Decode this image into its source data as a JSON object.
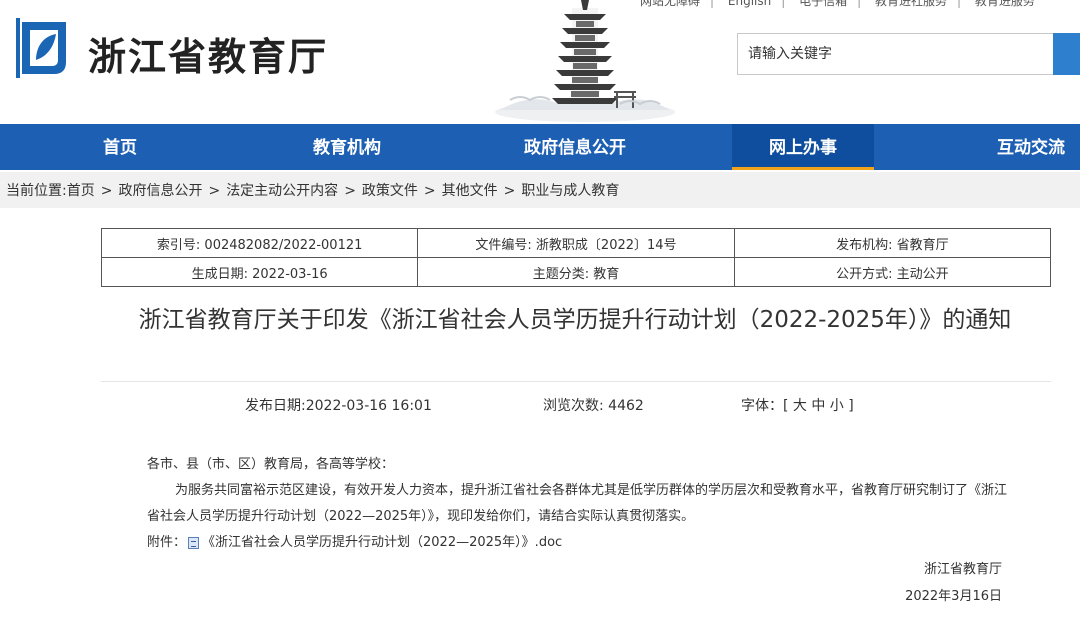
{
  "top_links": [
    "网站无障碍",
    "English",
    "电子信箱",
    "教育进社服务",
    "教育进服务"
  ],
  "site": {
    "name": "浙江省教育厅"
  },
  "search": {
    "placeholder": "请输入关键字"
  },
  "nav": {
    "items": [
      {
        "label": "首页"
      },
      {
        "label": "教育机构"
      },
      {
        "label": "政府信息公开"
      },
      {
        "label": "网上办事",
        "active": true
      },
      {
        "label": "互动交流"
      }
    ]
  },
  "breadcrumb": {
    "prefix": "当前位置:",
    "items": [
      "首页",
      "政府信息公开",
      "法定主动公开内容",
      "政策文件",
      "其他文件",
      "职业与成人教育"
    ]
  },
  "meta": {
    "index_no": "索引号: 002482082/2022-00121",
    "doc_no": "文件编号: 浙教职成〔2022〕14号",
    "publisher": "发布机构: 省教育厅",
    "created": "生成日期: 2022-03-16",
    "topic": "主题分类: 教育",
    "disclosure": "公开方式: 主动公开"
  },
  "article": {
    "title": "浙江省教育厅关于印发《浙江省社会人员学历提升行动计划（2022-2025年）》的通知",
    "publish_date": "发布日期:2022-03-16 16:01",
    "views": "浏览次数: 4462",
    "font_size_label": "字体：[ 大 中 小 ]",
    "salutation": "各市、县（市、区）教育局，各高等学校：",
    "paragraph": "为服务共同富裕示范区建设，有效开发人力资本，提升浙江省社会各群体尤其是低学历群体的学历层次和受教育水平，省教育厅研究制订了《浙江省社会人员学历提升行动计划（2022—2025年）》，现印发给你们，请结合实际认真贯彻落实。",
    "attachment_label": "附件：",
    "attachment_name": "《浙江省社会人员学历提升行动计划（2022—2025年）》.doc",
    "signature": "浙江省教育厅",
    "sign_date": "2022年3月16日"
  },
  "colors": {
    "nav_bg": "#1c5fb3",
    "nav_active": "#0f4e9e",
    "accent": "#f3a31a",
    "search_button": "#2e80cf"
  }
}
